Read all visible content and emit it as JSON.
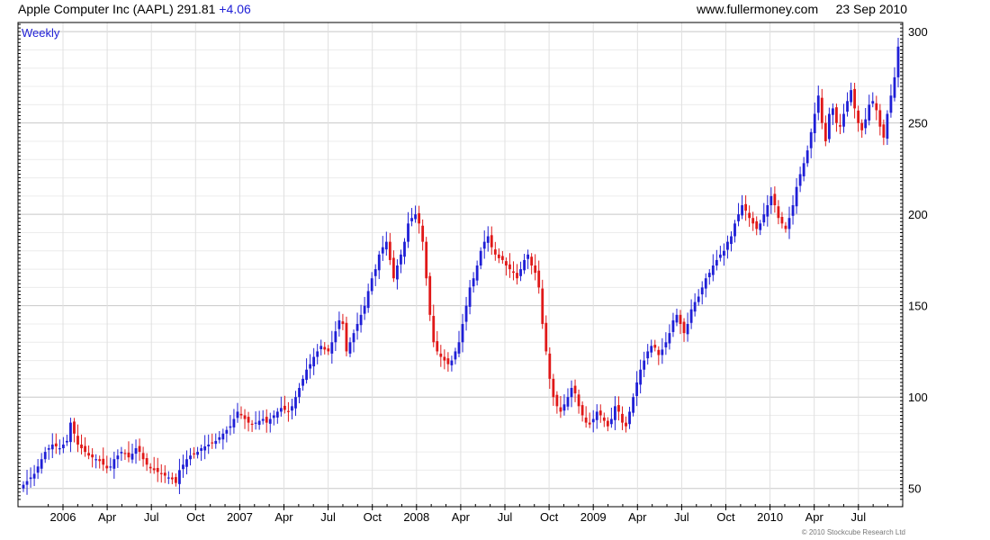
{
  "header": {
    "title": "Apple Computer Inc (AAPL)",
    "price": "291.81",
    "change": "+4.06",
    "source": "www.fullermoney.com",
    "date": "23 Sep 2010"
  },
  "chart_data": {
    "type": "candlestick",
    "interval_label": "Weekly",
    "ylim": [
      40,
      305
    ],
    "y_ticks": [
      50,
      100,
      150,
      200,
      250,
      300
    ],
    "x_ticks": [
      "2006",
      "Apr",
      "Jul",
      "Oct",
      "2007",
      "Apr",
      "Jul",
      "Oct",
      "2008",
      "Apr",
      "Jul",
      "Oct",
      "2009",
      "Apr",
      "Jul",
      "Oct",
      "2010",
      "Apr",
      "Jul"
    ],
    "grid": true,
    "up_color": "#1f1fd6",
    "down_color": "#e01818",
    "closes": [
      52,
      54,
      56,
      58,
      62,
      66,
      70,
      72,
      74,
      73,
      72,
      74,
      76,
      86,
      80,
      74,
      72,
      70,
      68,
      67,
      66,
      65,
      63,
      61,
      62,
      66,
      68,
      70,
      69,
      67,
      69,
      72,
      70,
      66,
      63,
      61,
      60,
      59,
      58,
      57,
      56,
      55,
      53,
      60,
      63,
      66,
      68,
      69,
      70,
      72,
      73,
      74,
      75,
      76,
      78,
      80,
      82,
      84,
      88,
      92,
      90,
      88,
      86,
      85,
      86,
      87,
      88,
      86,
      88,
      90,
      92,
      94,
      93,
      92,
      95,
      100,
      105,
      110,
      115,
      118,
      122,
      125,
      128,
      126,
      125,
      130,
      136,
      142,
      140,
      125,
      130,
      135,
      140,
      145,
      150,
      158,
      165,
      170,
      178,
      182,
      185,
      175,
      165,
      172,
      178,
      185,
      195,
      198,
      200,
      195,
      185,
      165,
      145,
      130,
      125,
      122,
      120,
      118,
      120,
      125,
      130,
      140,
      150,
      160,
      165,
      172,
      180,
      185,
      188,
      182,
      178,
      176,
      175,
      172,
      170,
      168,
      165,
      170,
      175,
      178,
      172,
      168,
      160,
      140,
      125,
      110,
      100,
      95,
      92,
      96,
      100,
      105,
      102,
      95,
      90,
      86,
      85,
      88,
      92,
      90,
      87,
      84,
      88,
      95,
      92,
      86,
      84,
      92,
      100,
      108,
      115,
      120,
      125,
      128,
      127,
      123,
      126,
      130,
      135,
      142,
      145,
      140,
      135,
      140,
      148,
      152,
      155,
      160,
      165,
      168,
      172,
      175,
      178,
      180,
      185,
      188,
      195,
      200,
      205,
      202,
      198,
      195,
      192,
      195,
      200,
      205,
      210,
      205,
      198,
      195,
      192,
      198,
      205,
      215,
      222,
      228,
      235,
      245,
      255,
      265,
      250,
      240,
      255,
      258,
      250,
      248,
      255,
      262,
      268,
      258,
      250,
      246,
      252,
      260,
      262,
      257,
      248,
      242,
      255,
      265,
      275,
      291.81
    ]
  },
  "footer": {
    "copyright": "© 2010 Stockcube Research Ltd"
  }
}
